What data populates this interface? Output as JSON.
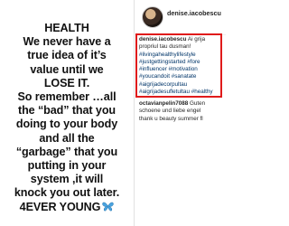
{
  "post_image": {
    "quote_lines": [
      "HEALTH",
      "We never have a",
      "true idea of it’s",
      "value until we",
      "LOSE IT.",
      "So remember …all",
      "the “bad” that you",
      "doing to your body",
      "and all the",
      "“garbage” that you",
      "putting in your",
      "system ,it will",
      "knock you out later.",
      "4EVER YOUNG"
    ],
    "butterfly_icon": "butterfly-icon",
    "butterfly_color": "#4aa3df"
  },
  "header": {
    "username": "denise.iacobescu"
  },
  "caption": {
    "username": "denise.iacobescu",
    "lines": [
      "Ai grija",
      "propriul tau dusman!",
      "#livingahealthylifestyle",
      "#justgettingstarted #fore",
      "#influencer #motivation",
      "#youcandoit #sanatate",
      "#aigrijadecorpultau",
      "#aigrijadesufletultau #healthy"
    ],
    "highlight_color": "#e01b1b"
  },
  "comment": {
    "username": "octavianpelin7088",
    "lines": [
      "Guten",
      "schoene und liebe engel",
      "thank u beauty summer fl"
    ]
  }
}
